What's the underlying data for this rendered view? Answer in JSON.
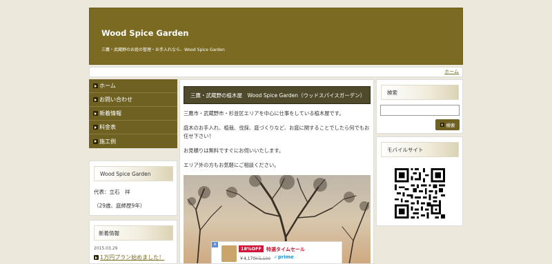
{
  "header": {
    "title": "Wood Spice Garden",
    "description": "三鷹・武蔵野のお庭の管理・お手入れなら、Wood Spice Garden"
  },
  "navbar": {
    "home": "ホーム"
  },
  "menu": {
    "items": [
      {
        "label": "ホーム"
      },
      {
        "label": "お問い合わせ"
      },
      {
        "label": "新着情報"
      },
      {
        "label": "料金表"
      },
      {
        "label": "施工例"
      }
    ]
  },
  "profile": {
    "heading": "Wood Spice Garden",
    "representative": "代表：立石　祥",
    "age": "（29歳、庭師歴9年）"
  },
  "news": {
    "heading": "新着情報",
    "date": "2015.03.29",
    "link": "1万円プラン始めました！"
  },
  "main": {
    "title": "三鷹・武蔵野の植木屋　Wood Spice Garden（ウッドスパイスガーデン）",
    "paragraphs": [
      "三鷹市・武蔵野市・杉並区エリアを中心に仕事をしている植木屋です。",
      "庭木のお手入れ、植栽、伐採、庭づくりなど、お庭に関することでしたら何でもお任せ下さい！",
      "お見積りは無料ですぐにお伺いいたします。",
      "エリア外の方もお気軽にご相談ください。"
    ]
  },
  "ad": {
    "badge": "A",
    "discount": "18%OFF",
    "sale": "特選タイムセール",
    "price": "￥4,170",
    "old_price": "￥5,100",
    "prime": "✓prime"
  },
  "sidebar": {
    "search_heading": "検索",
    "search_placeholder": "",
    "search_button": "検索",
    "mobile_heading": "モバイルサイト"
  },
  "colors": {
    "header_bg": "#7a6a22",
    "menu_bg": "#6e6122",
    "page_bg": "#ece8dc",
    "main_title_bg": "#4f4a2c"
  }
}
